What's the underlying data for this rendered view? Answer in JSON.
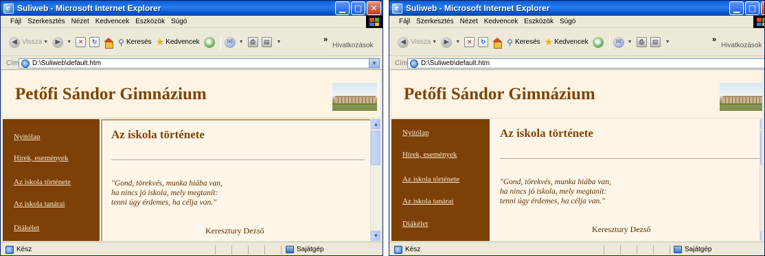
{
  "windows": [
    {
      "title": "Suliweb - Microsoft Internet Explorer",
      "menu": [
        "Fájl",
        "Szerkesztés",
        "Nézet",
        "Kedvencek",
        "Eszközök",
        "Súgó"
      ],
      "toolbar": {
        "back": "Vissza",
        "search": "Keresés",
        "favorites": "Kedvencek",
        "links": "Hivatkozások",
        "more": "»"
      },
      "address": {
        "label": "Cím",
        "value": "D:\\Suliweb\\default.htm"
      },
      "page": {
        "site_title": "Petőfi Sándor Gimnázium",
        "nav": [
          "Nyitólap",
          "Hírek, események",
          "Az iskola története",
          "Az iskola tanárai",
          "Diákélet"
        ],
        "heading": "Az iskola története",
        "poem": [
          "\"Gond, törekvés, munka hiába van,",
          "ha nincs jó iskola, mely megtanít:",
          "tenni úgy érdemes, ha célja van.\""
        ],
        "author": "Keresztury Dezső"
      },
      "status": {
        "text": "Kész",
        "zone": "Sajátgép"
      }
    },
    {
      "title": "Suliweb - Microsoft Internet Explorer",
      "menu": [
        "Fájl",
        "Szerkesztés",
        "Nézet",
        "Kedvencek",
        "Eszközök",
        "Súgó"
      ],
      "toolbar": {
        "back": "Vissza",
        "search": "Keresés",
        "favorites": "Kedvencek",
        "links": "Hivatkozások",
        "more": "»"
      },
      "address": {
        "label": "Cím",
        "value": "D:\\Suliweb\\default.htm"
      },
      "page": {
        "site_title": "Petőfi Sándor Gimnázium",
        "nav": [
          "Nyitólap",
          "Hírek, események",
          "Az iskola története",
          "Az iskola tanárai",
          "Diákélet"
        ],
        "heading": "Az iskola története",
        "poem": [
          "\"Gond, törekvés, munka hiába van,",
          "ha nincs jó iskola, mely megtanít:",
          "tenni úgy érdemes, ha célja van.\""
        ],
        "author": "Keresztury Dezső"
      },
      "status": {
        "text": "Kész",
        "zone": "Sajátgép"
      }
    }
  ],
  "colors": {
    "accent_brown": "#7e4405",
    "sidebar_brown": "#7d4006",
    "page_bg": "#fef6e8",
    "xp_blue": "#0a5fd8"
  }
}
